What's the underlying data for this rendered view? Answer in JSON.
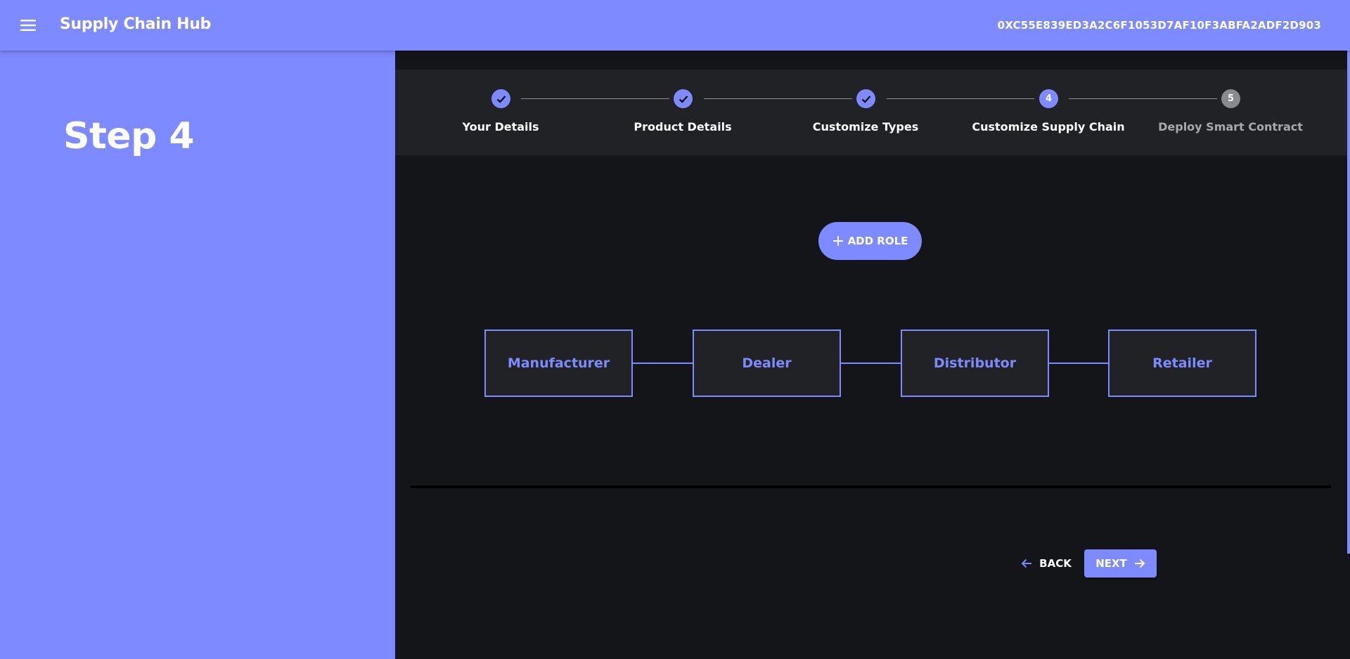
{
  "appbar": {
    "title": "Supply Chain Hub",
    "wallet_address": "0XC55E839ED3A2C6F1053D7AF10F3ABFA2ADF2D903",
    "menu_icon": "hamburger-menu-icon"
  },
  "sidebar": {
    "heading": "Step 4"
  },
  "stepper": {
    "steps": [
      {
        "label": "Your Details",
        "state": "completed",
        "indicator": "check-icon"
      },
      {
        "label": "Product Details",
        "state": "completed",
        "indicator": "check-icon"
      },
      {
        "label": "Customize Types",
        "state": "completed",
        "indicator": "check-icon"
      },
      {
        "label": "Customize Supply Chain",
        "state": "active",
        "number": "4"
      },
      {
        "label": "Deploy Smart Contract",
        "state": "inactive",
        "number": "5"
      }
    ]
  },
  "add_role_button": {
    "label": "ADD ROLE",
    "icon": "plus-icon"
  },
  "roles": [
    {
      "name": "Manufacturer"
    },
    {
      "name": "Dealer"
    },
    {
      "name": "Distributor"
    },
    {
      "name": "Retailer"
    }
  ],
  "navigation": {
    "back_label": "BACK",
    "next_label": "NEXT"
  },
  "colors": {
    "accent": "#7e8aff",
    "background_dark": "#141519",
    "panel_dark": "#212226",
    "inactive_step": "#8a8a8e"
  }
}
